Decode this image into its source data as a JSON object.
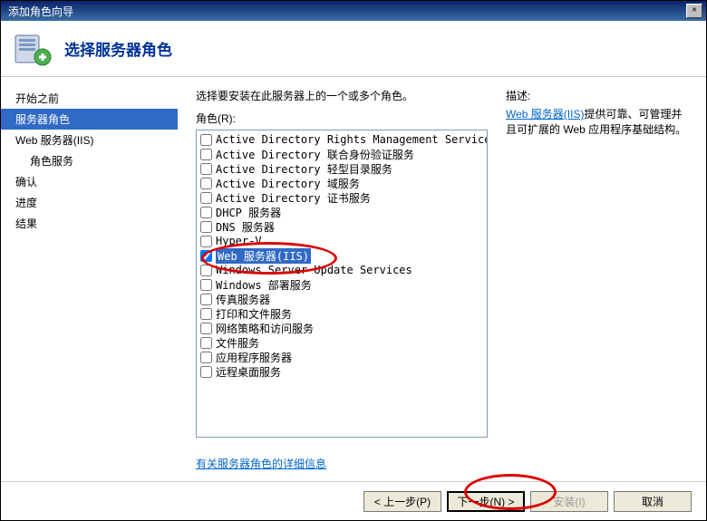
{
  "window": {
    "title": "添加角色向导"
  },
  "header": {
    "title": "选择服务器角色"
  },
  "sidebar": {
    "items": [
      {
        "label": "开始之前",
        "selected": false,
        "indent": false
      },
      {
        "label": "服务器角色",
        "selected": true,
        "indent": false
      },
      {
        "label": "Web 服务器(IIS)",
        "selected": false,
        "indent": false
      },
      {
        "label": "角色服务",
        "selected": false,
        "indent": true
      },
      {
        "label": "确认",
        "selected": false,
        "indent": false
      },
      {
        "label": "进度",
        "selected": false,
        "indent": false
      },
      {
        "label": "结果",
        "selected": false,
        "indent": false
      }
    ]
  },
  "main": {
    "instruction": "选择要安装在此服务器上的一个或多个角色。",
    "roles_label": "角色(R):",
    "roles": [
      {
        "label": "Active Directory Rights Management Services",
        "checked": false,
        "selected": false
      },
      {
        "label": "Active Directory 联合身份验证服务",
        "checked": false,
        "selected": false
      },
      {
        "label": "Active Directory 轻型目录服务",
        "checked": false,
        "selected": false
      },
      {
        "label": "Active Directory 域服务",
        "checked": false,
        "selected": false
      },
      {
        "label": "Active Directory 证书服务",
        "checked": false,
        "selected": false
      },
      {
        "label": "DHCP 服务器",
        "checked": false,
        "selected": false
      },
      {
        "label": "DNS 服务器",
        "checked": false,
        "selected": false
      },
      {
        "label": "Hyper-V",
        "checked": false,
        "selected": false
      },
      {
        "label": "Web 服务器(IIS)",
        "checked": true,
        "selected": true
      },
      {
        "label": "Windows Server Update Services",
        "checked": false,
        "selected": false
      },
      {
        "label": "Windows 部署服务",
        "checked": false,
        "selected": false
      },
      {
        "label": "传真服务器",
        "checked": false,
        "selected": false
      },
      {
        "label": "打印和文件服务",
        "checked": false,
        "selected": false
      },
      {
        "label": "网络策略和访问服务",
        "checked": false,
        "selected": false
      },
      {
        "label": "文件服务",
        "checked": false,
        "selected": false
      },
      {
        "label": "应用程序服务器",
        "checked": false,
        "selected": false
      },
      {
        "label": "远程桌面服务",
        "checked": false,
        "selected": false
      }
    ],
    "more_link": "有关服务器角色的详细信息",
    "description": {
      "title": "描述:",
      "link_text": "Web 服务器(IIS)",
      "text": "提供可靠、可管理并且可扩展的 Web 应用程序基础结构。"
    }
  },
  "footer": {
    "previous": "< 上一步(P)",
    "next": "下一步(N) >",
    "install": "安装(I)",
    "cancel": "取消"
  }
}
